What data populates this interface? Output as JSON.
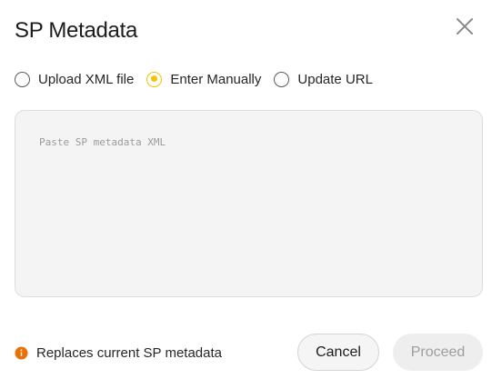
{
  "dialog": {
    "title": "SP Metadata",
    "close_icon": "close-icon"
  },
  "source_options": {
    "items": [
      {
        "label": "Upload XML file",
        "selected": false
      },
      {
        "label": "Enter Manually",
        "selected": true
      },
      {
        "label": "Update URL",
        "selected": false
      }
    ]
  },
  "metadata_input": {
    "value": "",
    "placeholder": "Paste SP metadata XML"
  },
  "footer": {
    "note": "Replaces current SP metadata",
    "note_icon": "info-icon",
    "cancel_label": "Cancel",
    "proceed_label": "Proceed",
    "proceed_enabled": false
  },
  "colors": {
    "accent_yellow": "#f5c400",
    "warning_orange": "#e8710a",
    "textarea_bg": "#f4f4f4"
  }
}
